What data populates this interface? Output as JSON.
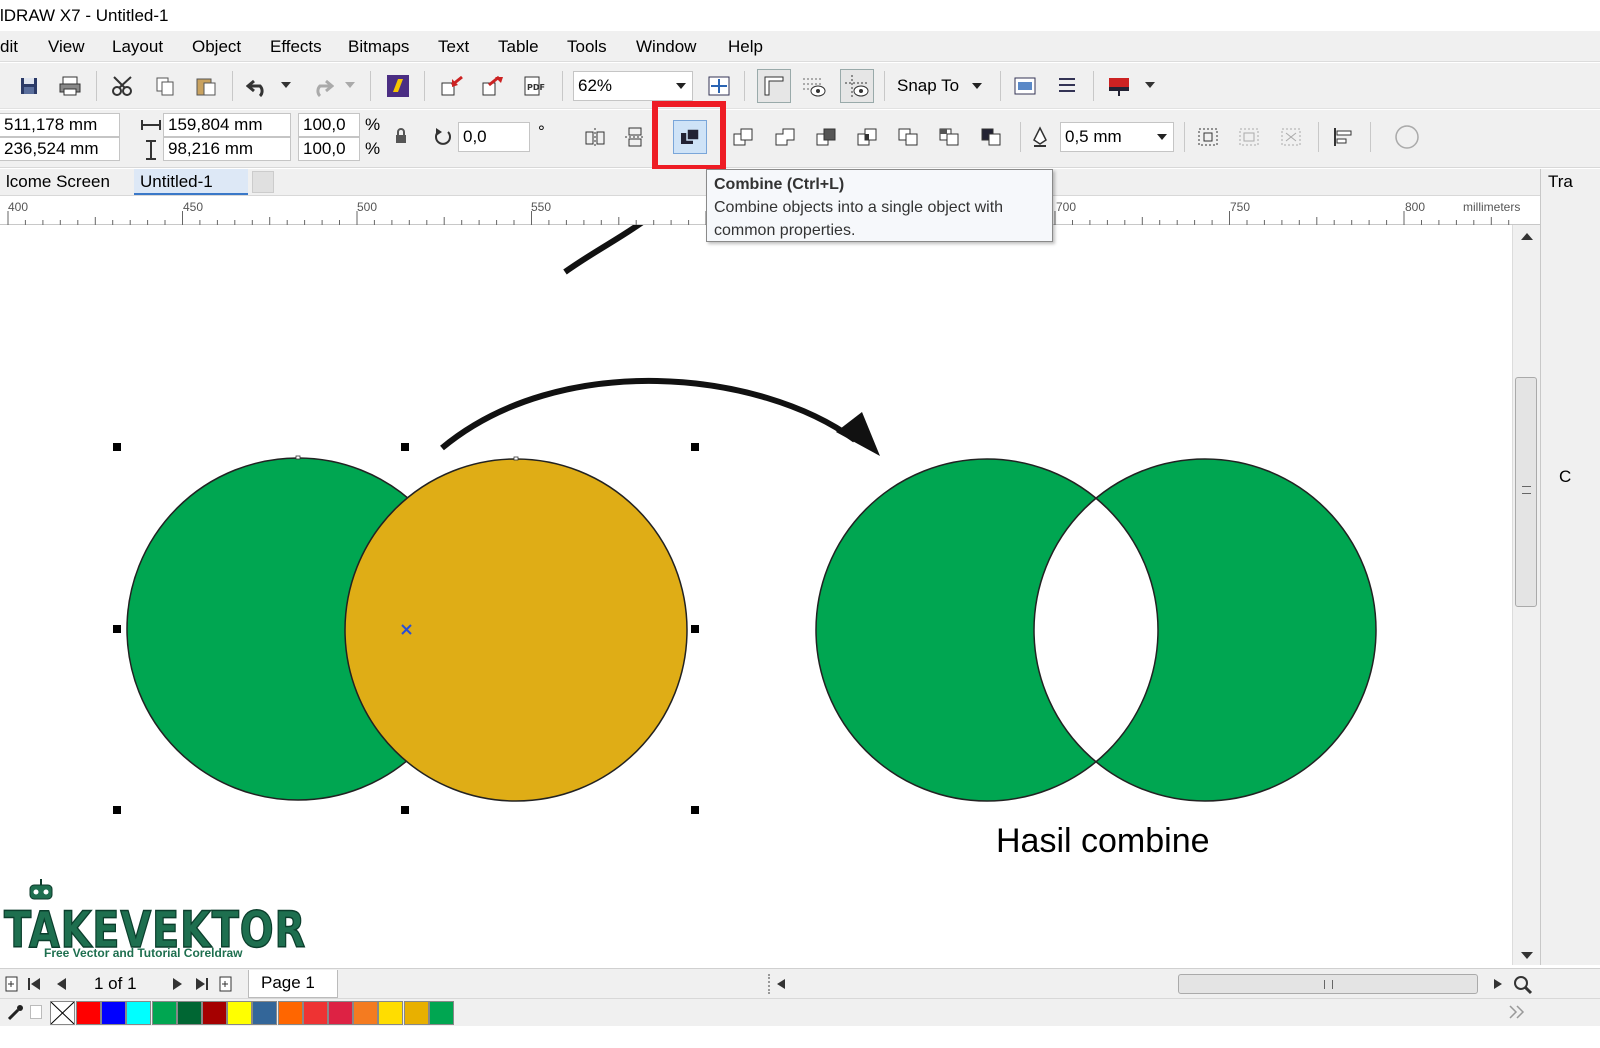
{
  "app": {
    "title": "lDRAW X7 - Untitled-1"
  },
  "menu": [
    "dit",
    "View",
    "Layout",
    "Object",
    "Effects",
    "Bitmaps",
    "Text",
    "Table",
    "Tools",
    "Window",
    "Help"
  ],
  "toolbar": {
    "zoom_value": "62%",
    "snap_to_label": "Snap To",
    "icons": [
      "save-icon",
      "print-icon",
      "cut-icon",
      "copy-icon",
      "paste-icon",
      "undo-icon",
      "redo-icon",
      "search-content-icon",
      "import-icon",
      "export-icon",
      "pdf-icon",
      "zoom-fit-icon",
      "rulers-icon",
      "grid-icon",
      "guidelines-icon",
      "options-icon",
      "application-launcher-icon"
    ]
  },
  "property_bar": {
    "x_value": "511,178 mm",
    "y_value": "236,524 mm",
    "width_value": "159,804 mm",
    "height_value": "98,216 mm",
    "scale_x": "100,0",
    "scale_y": "100,0",
    "percent_symbol": "%",
    "rotation_value": "0,0",
    "degree_symbol": "°",
    "outline_width": "0,5 mm"
  },
  "tabs": [
    {
      "label": "lcome Screen",
      "active": false
    },
    {
      "label": "Untitled-1",
      "active": true
    }
  ],
  "ruler": {
    "labels": [
      "400",
      "450",
      "500",
      "550",
      "700",
      "750",
      "800"
    ],
    "unit": "millimeters"
  },
  "tooltip": {
    "title": "Combine (Ctrl+L)",
    "description": "Combine  objects into a single object with common properties."
  },
  "canvas": {
    "result_label": "Hasil combine",
    "shapes": {
      "circle_left_color": "#00a651",
      "circle_right_color": "#dfad16",
      "result_color": "#00a651"
    }
  },
  "right_dock": {
    "label": "Tra",
    "label2": "C"
  },
  "page_nav": {
    "page_count": "1 of 1",
    "page_tab": "Page 1"
  },
  "logo": {
    "name": "TAKEVEKTOR",
    "tagline": "Free Vector and Tutorial Coreldraw"
  },
  "palette": [
    "#ff0000",
    "#0000ff",
    "#00ffff",
    "#00a651",
    "#006633",
    "#a50000",
    "#ffff00",
    "#336699",
    "#ff6600",
    "#ee3333",
    "#dd2244",
    "#f47b20",
    "#ffdd00",
    "#e8b000",
    "#00a651"
  ]
}
